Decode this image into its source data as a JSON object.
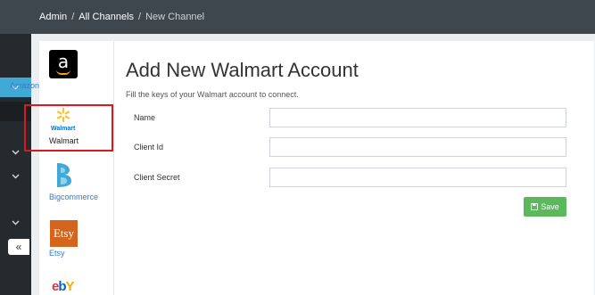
{
  "breadcrumb": {
    "items": [
      "Admin",
      "All Channels",
      "New Channel"
    ],
    "separator": "/"
  },
  "nav": {
    "collapse_label": "«"
  },
  "channels": [
    {
      "name": "Amazon",
      "icon": "amazon-logo-icon",
      "logo_text": "a",
      "selected": false
    },
    {
      "name": "Walmart",
      "icon": "walmart-spark-icon",
      "logo_text": "Walmart",
      "selected": true
    },
    {
      "name": "Bigcommerce",
      "icon": "bigcommerce-logo-icon",
      "selected": false
    },
    {
      "name": "Etsy",
      "icon": "etsy-logo-icon",
      "logo_text": "Etsy",
      "selected": false
    },
    {
      "name": "eBay",
      "icon": "ebay-logo-icon",
      "logo_text": "ebY",
      "selected": false
    }
  ],
  "form": {
    "title": "Add New Walmart Account",
    "subtitle": "Fill the keys of your Walmart account to connect.",
    "fields": [
      {
        "label": "Name",
        "value": "",
        "placeholder": ""
      },
      {
        "label": "Client Id",
        "value": "",
        "placeholder": ""
      },
      {
        "label": "Client Secret",
        "value": "",
        "placeholder": ""
      }
    ],
    "save_label": "Save"
  },
  "colors": {
    "topbar": "#3e474e",
    "sidebar": "#252a2e",
    "active_nav": "#41a9d6",
    "save_button": "#5cb85c",
    "selection_outline": "#d9191c",
    "link": "#3a7bbd"
  }
}
